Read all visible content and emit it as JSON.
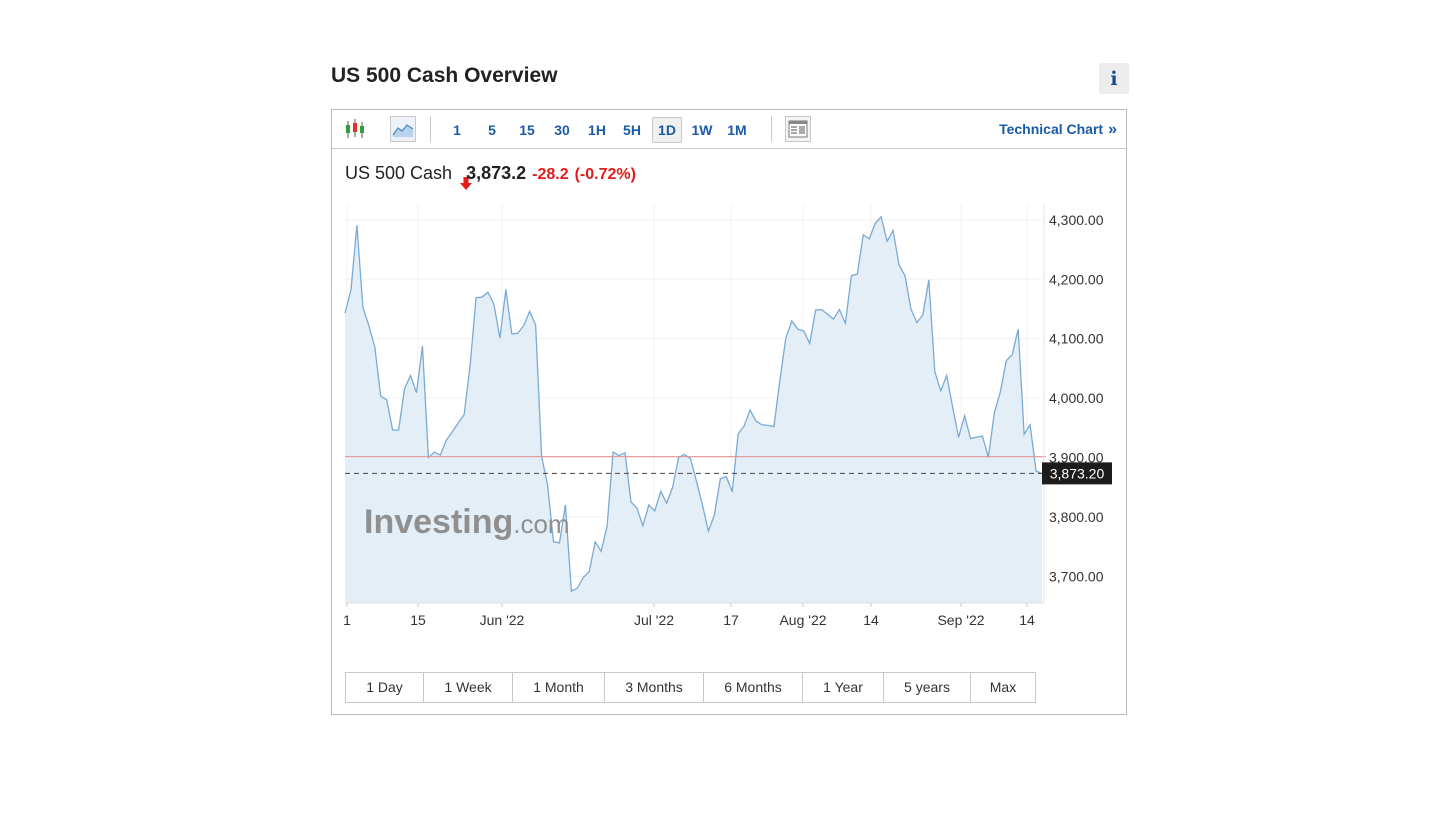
{
  "page": {
    "title": "US 500 Cash Overview",
    "info_glyph": "i"
  },
  "toolbar": {
    "icons": [
      "candlestick-icon",
      "area-chart-icon"
    ],
    "timeframes": [
      "1",
      "5",
      "15",
      "30",
      "1H",
      "5H",
      "1D",
      "1W",
      "1M"
    ],
    "active_timeframe": "1D",
    "layout_icon": "table-layout-icon",
    "technical_link": "Technical Chart",
    "technical_chevron": "»"
  },
  "quote": {
    "name": "US 500 Cash",
    "price": "3,873.2",
    "change": "-28.2",
    "change_pct": "(-0.72%)",
    "direction": "down",
    "down_color": "#e51a1a"
  },
  "watermark": {
    "text_main": "Investing",
    "text_suffix": ".com"
  },
  "chart_data": {
    "type": "area",
    "y_ticks": [
      "4,300.00",
      "4,200.00",
      "4,100.00",
      "4,000.00",
      "3,900.00",
      "3,800.00",
      "3,700.00"
    ],
    "x_ticks": [
      "1",
      "15",
      "Jun '22",
      "Jul '22",
      "17",
      "Aug '22",
      "14",
      "Sep '22",
      "14"
    ],
    "ylim": [
      3655,
      4325
    ],
    "y_tick_values": [
      4300,
      4200,
      4100,
      4000,
      3900,
      3800,
      3700
    ],
    "series_color": "#7aaad4",
    "fill_color": "#e4eef6",
    "reference_line": {
      "value": 3901.4,
      "color": "#e68f8f"
    },
    "current_line": {
      "value": 3873.2,
      "label": "3,873.20"
    },
    "grid": true,
    "values": [
      4143,
      4182,
      4291,
      4153,
      4122,
      4086,
      4003,
      3997,
      3946,
      3946,
      4016,
      4038,
      4009,
      4088,
      3900,
      3909,
      3904,
      3929,
      3943,
      3958,
      3972,
      4055,
      4169,
      4170,
      4178,
      4158,
      4101,
      4183,
      4108,
      4109,
      4122,
      4146,
      4123,
      3902,
      3854,
      3758,
      3756,
      3820,
      3675,
      3680,
      3698,
      3708,
      3758,
      3742,
      3785,
      3909,
      3903,
      3908,
      3825,
      3815,
      3785,
      3820,
      3810,
      3843,
      3823,
      3850,
      3900,
      3905,
      3898,
      3860,
      3820,
      3776,
      3803,
      3864,
      3868,
      3842,
      3940,
      3953,
      3980,
      3961,
      3955,
      3954,
      3952,
      4030,
      4101,
      4130,
      4116,
      4113,
      4092,
      4148,
      4149,
      4141,
      4133,
      4149,
      4126,
      4206,
      4209,
      4275,
      4268,
      4294,
      4305,
      4264,
      4282,
      4224,
      4206,
      4150,
      4127,
      4140,
      4199,
      4045,
      4012,
      4038,
      3985,
      3934,
      3970,
      3932,
      3934,
      3936,
      3900,
      3975,
      4010,
      4063,
      4073,
      4116,
      3939,
      3955,
      3877,
      3873
    ]
  },
  "ranges": [
    "1 Day",
    "1 Week",
    "1 Month",
    "3 Months",
    "6 Months",
    "1 Year",
    "5 years",
    "Max"
  ]
}
